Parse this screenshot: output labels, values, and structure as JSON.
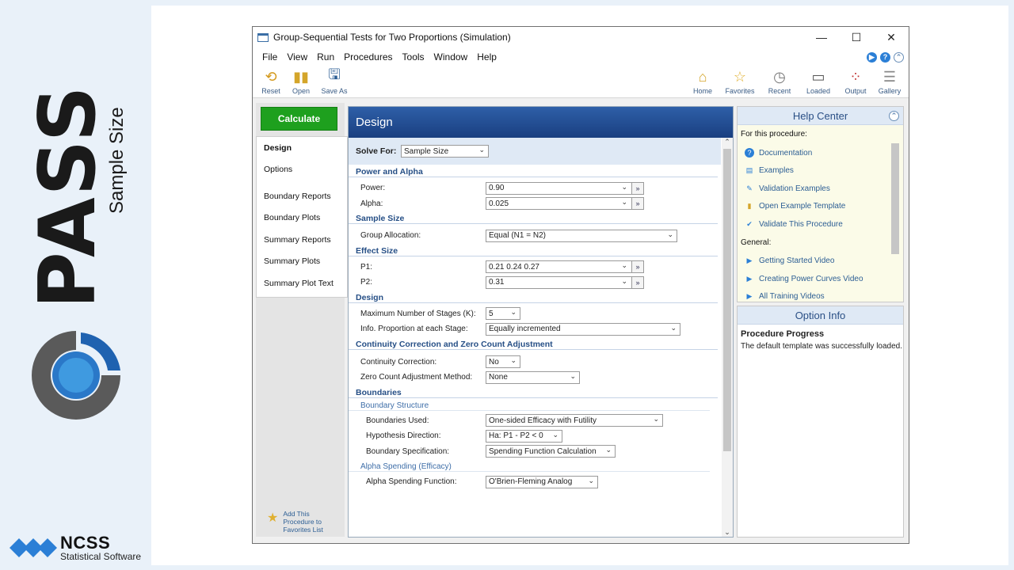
{
  "branding": {
    "product": "PASS",
    "tagline": "Sample Size",
    "company": "NCSS",
    "company_sub": "Statistical Software"
  },
  "window": {
    "title": "Group-Sequential Tests for Two Proportions (Simulation)",
    "minimize": "—",
    "maximize": "☐",
    "close": "✕"
  },
  "menu": [
    "File",
    "View",
    "Run",
    "Procedures",
    "Tools",
    "Window",
    "Help"
  ],
  "toolbar": {
    "left": [
      {
        "label": "Reset",
        "icon": "reset-icon"
      },
      {
        "label": "Open",
        "icon": "open-icon"
      },
      {
        "label": "Save As",
        "icon": "save-icon"
      }
    ],
    "right": [
      {
        "label": "Home",
        "icon": "home-icon"
      },
      {
        "label": "Favorites",
        "icon": "star-icon"
      },
      {
        "label": "Recent",
        "icon": "clock-icon"
      },
      {
        "label": "Loaded",
        "icon": "window-icon"
      },
      {
        "label": "Output",
        "icon": "output-icon"
      },
      {
        "label": "Gallery",
        "icon": "gallery-icon"
      }
    ]
  },
  "nav": {
    "calculate": "Calculate",
    "items": [
      "Design",
      "Options",
      "Boundary Reports",
      "Boundary Plots",
      "Summary Reports",
      "Summary Plots",
      "Summary Plot Text"
    ],
    "add_favorite": "Add This Procedure to Favorites List"
  },
  "design": {
    "header": "Design",
    "solve_for_label": "Solve For:",
    "solve_for_value": "Sample Size",
    "sections": {
      "power_alpha": "Power and Alpha",
      "sample_size": "Sample Size",
      "effect_size": "Effect Size",
      "design": "Design",
      "continuity": "Continuity Correction and Zero Count Adjustment",
      "boundaries": "Boundaries",
      "boundary_structure": "Boundary Structure",
      "alpha_spending": "Alpha Spending (Efficacy)"
    },
    "fields": {
      "power": {
        "label": "Power:",
        "value": "0.90"
      },
      "alpha": {
        "label": "Alpha:",
        "value": "0.025"
      },
      "group_allocation": {
        "label": "Group Allocation:",
        "value": "Equal (N1 = N2)"
      },
      "p1": {
        "label": "P1:",
        "value": "0.21 0.24 0.27"
      },
      "p2": {
        "label": "P2:",
        "value": "0.31"
      },
      "max_stages": {
        "label": "Maximum Number of Stages (K):",
        "value": "5"
      },
      "info_proportion": {
        "label": "Info. Proportion at each Stage:",
        "value": "Equally incremented"
      },
      "continuity_correction": {
        "label": "Continuity Correction:",
        "value": "No"
      },
      "zero_count": {
        "label": "Zero Count Adjustment Method:",
        "value": "None"
      },
      "boundaries_used": {
        "label": "Boundaries Used:",
        "value": "One-sided Efficacy with Futility"
      },
      "hypothesis_direction": {
        "label": "Hypothesis Direction:",
        "value": "Ha: P1 - P2 < 0"
      },
      "boundary_spec": {
        "label": "Boundary Specification:",
        "value": "Spending Function Calculation"
      },
      "alpha_spending_fn": {
        "label": "Alpha Spending Function:",
        "value": "O'Brien-Fleming Analog"
      }
    }
  },
  "help_center": {
    "title": "Help Center",
    "for_procedure": "For this procedure:",
    "procedure_links": [
      "Documentation",
      "Examples",
      "Validation Examples",
      "Open Example Template",
      "Validate This Procedure"
    ],
    "general": "General:",
    "general_links": [
      "Getting Started Video",
      "Creating Power Curves Video",
      "All Training Videos"
    ]
  },
  "option_info": {
    "title": "Option Info",
    "heading": "Procedure Progress",
    "text": "The default template was successfully loaded."
  },
  "colors": {
    "calculate_green": "#1ea01e",
    "design_header_blue": "#1f4a8f",
    "section_blue": "#264f86",
    "help_bg": "#fbfbe8"
  }
}
